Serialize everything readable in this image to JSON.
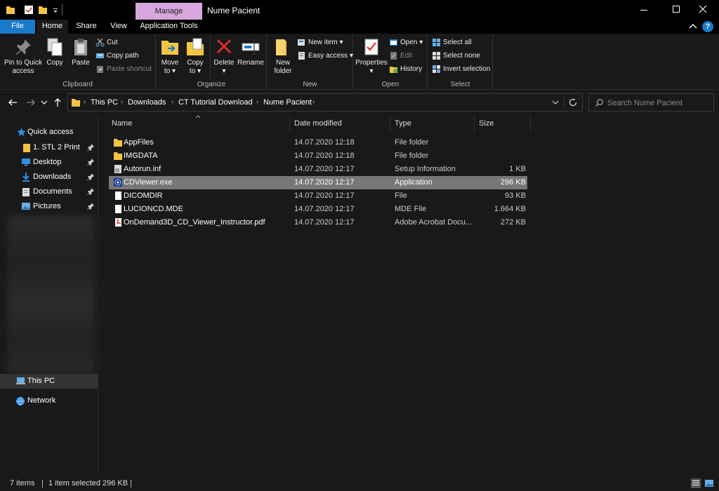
{
  "window": {
    "context_tab": "Manage",
    "title": "Nume Pacient"
  },
  "tabs": {
    "file": "File",
    "home": "Home",
    "share": "Share",
    "view": "View",
    "app_tools": "Application Tools",
    "help": "?"
  },
  "ribbon": {
    "clipboard": {
      "label": "Clipboard",
      "pin_line1": "Pin to Quick",
      "pin_line2": "access",
      "copy": "Copy",
      "paste": "Paste",
      "cut": "Cut",
      "copy_path": "Copy path",
      "paste_shortcut": "Paste shortcut"
    },
    "organize": {
      "label": "Organize",
      "move_line1": "Move",
      "move_line2": "to",
      "copy_line1": "Copy",
      "copy_line2": "to",
      "delete": "Delete",
      "rename": "Rename"
    },
    "new": {
      "label": "New",
      "new_folder_line1": "New",
      "new_folder_line2": "folder",
      "new_item": "New item",
      "easy_access": "Easy access"
    },
    "open": {
      "label": "Open",
      "properties": "Properties",
      "open": "Open",
      "edit": "Edit",
      "history": "History"
    },
    "select": {
      "label": "Select",
      "select_all": "Select all",
      "select_none": "Select none",
      "invert_selection": "Invert selection"
    }
  },
  "address": {
    "crumbs": [
      "This PC",
      "Downloads",
      "CT Tutorial Download",
      "Nume Pacient"
    ]
  },
  "search": {
    "placeholder": "Search Nume Pacient"
  },
  "nav": {
    "quick_access": "Quick access",
    "pinned": [
      "1. STL 2 Print",
      "Desktop",
      "Downloads",
      "Documents",
      "Pictures"
    ],
    "this_pc": "This PC",
    "network": "Network"
  },
  "columns": {
    "name": "Name",
    "date": "Date modified",
    "type": "Type",
    "size": "Size"
  },
  "files": [
    {
      "name": "AppFiles",
      "date": "14.07.2020 12:18",
      "type": "File folder",
      "size": "",
      "icon": "folder-icon"
    },
    {
      "name": "IMGDATA",
      "date": "14.07.2020 12:18",
      "type": "File folder",
      "size": "",
      "icon": "folder-icon"
    },
    {
      "name": "Autorun.inf",
      "date": "14.07.2020 12:17",
      "type": "Setup Information",
      "size": "1 KB",
      "icon": "setup-file-icon"
    },
    {
      "name": "CDViewer.exe",
      "date": "14.07.2020 12:17",
      "type": "Application",
      "size": "296 KB",
      "icon": "application-icon"
    },
    {
      "name": "DICOMDIR",
      "date": "14.07.2020 12:17",
      "type": "File",
      "size": "93 KB",
      "icon": "file-icon"
    },
    {
      "name": "LUCIONCD.MDE",
      "date": "14.07.2020 12:17",
      "type": "MDE File",
      "size": "1.664 KB",
      "icon": "file-icon"
    },
    {
      "name": "OnDemand3D_CD_Viewer_Instructor.pdf",
      "date": "14.07.2020 12:17",
      "type": "Adobe Acrobat Docu...",
      "size": "272 KB",
      "icon": "pdf-icon"
    }
  ],
  "status": {
    "items": "7 items",
    "selected": "1 item selected",
    "size": "296 KB"
  },
  "colors": {
    "accent": "#1979ca",
    "manage_tab": "#d6a6dc",
    "folder": "#f4c542",
    "selection": "#777777"
  }
}
